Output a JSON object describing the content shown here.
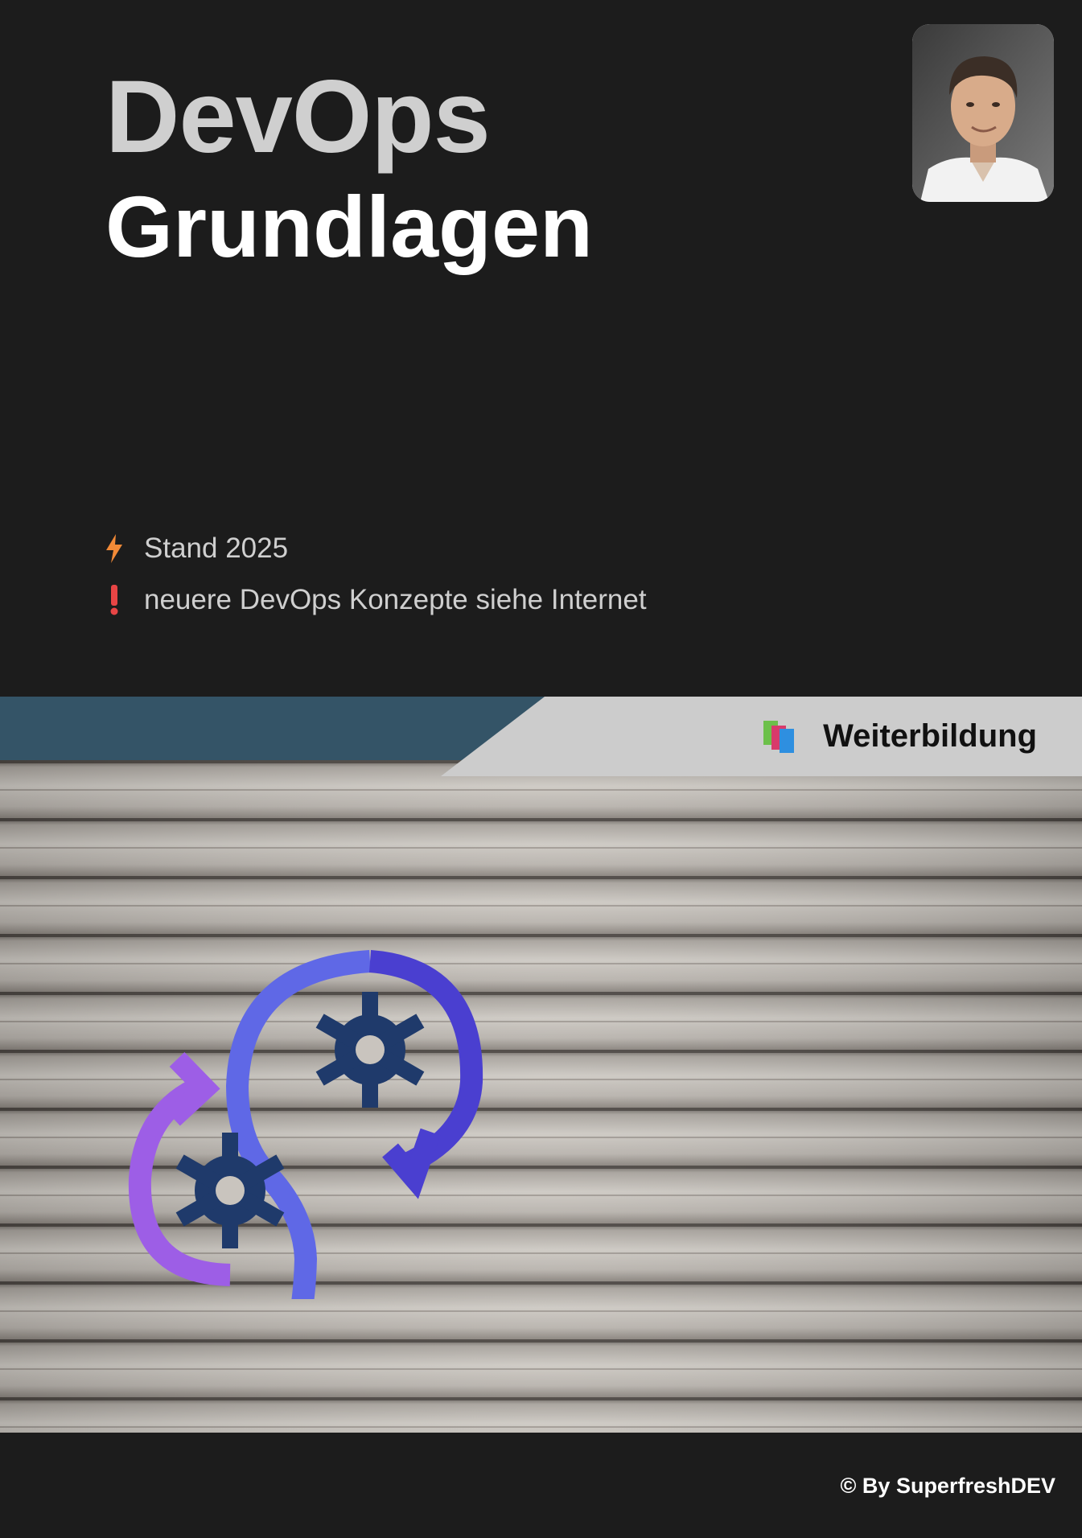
{
  "cover": {
    "title": "DevOps",
    "subtitle": "Grundlagen",
    "notes": [
      {
        "icon": "lightning-icon",
        "text": "Stand 2025"
      },
      {
        "icon": "exclamation-icon",
        "text": "neuere DevOps Konzepte siehe Internet"
      }
    ],
    "category": {
      "icon": "books-icon",
      "label": "Weiterbildung"
    },
    "copyright": "© By SuperfreshDEV"
  },
  "colors": {
    "background": "#1c1c1c",
    "title": "#cfcfcf",
    "subtitle": "#ffffff",
    "band_blue": "#345467",
    "band_grey": "#cccccc",
    "lightning": "#f28a37",
    "exclamation": "#e84545",
    "logo_blue": "#5865e8",
    "logo_purple": "#9d5ee6",
    "gear": "#1f3a6b"
  }
}
